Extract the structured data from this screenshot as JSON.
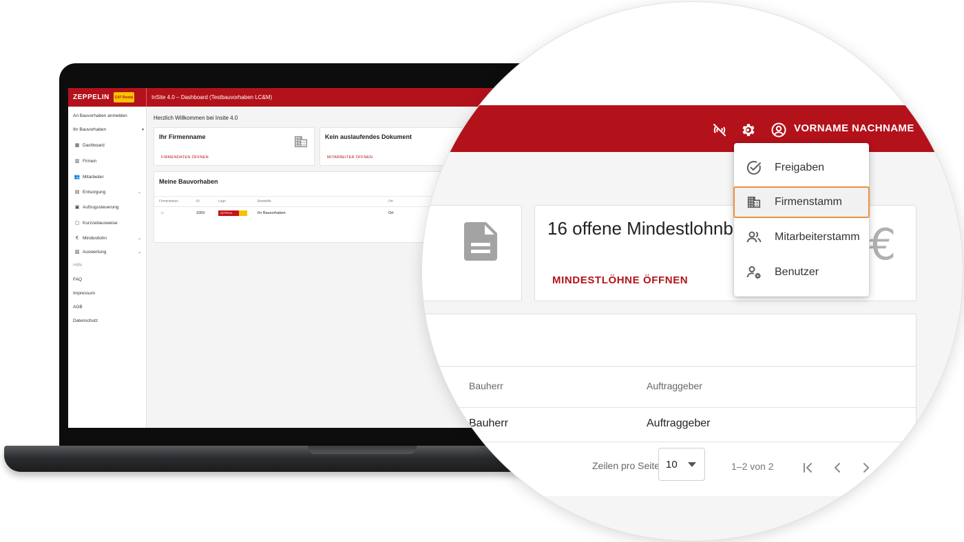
{
  "laptop": {
    "brand": "ZEPPELIN",
    "brand_badge": "CAT Rental",
    "app_title": "InSite 4.0 – Dashboard (Testbauvorhaben LC&M)",
    "sidebar": {
      "items": [
        {
          "label": "An Bauvorhaben anmelden"
        },
        {
          "label": "Ihr Bauvorhaben"
        },
        {
          "label": "Dashboard"
        },
        {
          "label": "Firmen"
        },
        {
          "label": "Mitarbeiter"
        },
        {
          "label": "Entsorgung"
        },
        {
          "label": "Aufzugssteuerung"
        },
        {
          "label": "Kurzzeitausweise"
        },
        {
          "label": "Mindestlohn"
        },
        {
          "label": "Auswertung"
        },
        {
          "label": "Hilfe"
        },
        {
          "label": "FAQ"
        },
        {
          "label": "Impressum"
        },
        {
          "label": "AGB"
        },
        {
          "label": "Datenschutz"
        }
      ]
    },
    "main": {
      "welcome": "Herzlich Willkommen bei Insite 4.0",
      "card_company": {
        "title": "Ihr Firmenname",
        "link": "FIRMENDATEN ÖFFNEN"
      },
      "card_docs": {
        "title": "Kein auslaufendes Dokument",
        "link": "MITARBEITER ÖFFNEN"
      },
      "projects": {
        "title": "Meine Bauvorhaben",
        "columns": [
          "Firmenstatus",
          "ID",
          "Logo",
          "Baustelle",
          "Ort"
        ],
        "rows": [
          {
            "id": "1003",
            "logo": "ZEPPELIN",
            "baustelle": "Ihr Bauvorhaben",
            "ort": "Ort"
          }
        ]
      }
    }
  },
  "zoom": {
    "header": {
      "user_name": "VORNAME NACHNAME",
      "icons": [
        "wifi-off-icon",
        "gear-icon",
        "account-circle-icon"
      ]
    },
    "menu": {
      "items": [
        {
          "label": "Freigaben",
          "icon": "check-circle-icon"
        },
        {
          "label": "Firmenstamm",
          "icon": "building-icon",
          "active": true
        },
        {
          "label": "Mitarbeiterstamm",
          "icon": "people-icon"
        },
        {
          "label": "Benutzer",
          "icon": "user-settings-icon"
        }
      ]
    },
    "card_mindestlohn": {
      "title": "16 offene Mindestlohnbe",
      "link": "MINDESTLÖHNE ÖFFNEN"
    },
    "table": {
      "columns": [
        "Bauherr",
        "Auftraggeber"
      ],
      "row": [
        "Bauherr",
        "Auftraggeber"
      ]
    },
    "pagination": {
      "rows_per_page_label": "Zeilen pro Seite",
      "rows_per_page_value": "10",
      "range": "1–2 von 2"
    }
  },
  "colors": {
    "brand_red": "#b3121b",
    "highlight_orange": "#e8923b"
  }
}
